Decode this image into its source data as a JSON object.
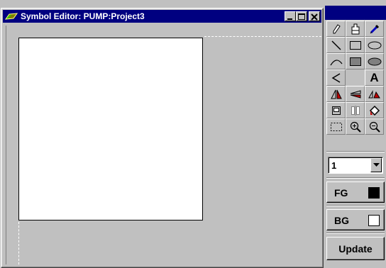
{
  "window": {
    "title": "Symbol Editor: PUMP:Project3",
    "icon": "pump-app-icon",
    "buttons": [
      "minimize-icon",
      "maximize-icon",
      "close-icon"
    ]
  },
  "palette": {
    "tools": [
      {
        "name": "pencil-tool",
        "icon": "pencil-icon"
      },
      {
        "name": "fill-tool",
        "icon": "paint-bucket-icon"
      },
      {
        "name": "eyedropper-tool",
        "icon": "eyedropper-icon"
      },
      {
        "name": "line-tool",
        "icon": "line-icon"
      },
      {
        "name": "rectangle-tool",
        "icon": "rectangle-outline-icon"
      },
      {
        "name": "ellipse-tool",
        "icon": "ellipse-outline-icon"
      },
      {
        "name": "arc-tool",
        "icon": "arc-icon"
      },
      {
        "name": "filled-rectangle-tool",
        "icon": "rectangle-filled-icon"
      },
      {
        "name": "filled-ellipse-tool",
        "icon": "ellipse-filled-icon"
      },
      {
        "name": "polyline-tool",
        "icon": "polyline-icon"
      },
      {
        "name": "empty",
        "icon": ""
      },
      {
        "name": "text-tool",
        "icon": "text-icon",
        "glyph": "A"
      },
      {
        "name": "flip-horizontal-tool",
        "icon": "flip-horizontal-icon"
      },
      {
        "name": "flip-vertical-tool",
        "icon": "flip-vertical-icon"
      },
      {
        "name": "rotate-tool",
        "icon": "rotate-icon"
      },
      {
        "name": "frame-tool",
        "icon": "frame-icon"
      },
      {
        "name": "mirror-tool",
        "icon": "mirror-icon"
      },
      {
        "name": "color-fill-tool",
        "icon": "color-fill-icon"
      },
      {
        "name": "select-tool",
        "icon": "marquee-select-icon"
      },
      {
        "name": "zoom-in-tool",
        "icon": "zoom-in-icon"
      },
      {
        "name": "zoom-out-tool",
        "icon": "zoom-out-icon"
      }
    ],
    "line_width": "1",
    "fg_label": "FG",
    "fg_color": "#000000",
    "bg_label": "BG",
    "bg_color": "#ffffff",
    "update_label": "Update"
  }
}
